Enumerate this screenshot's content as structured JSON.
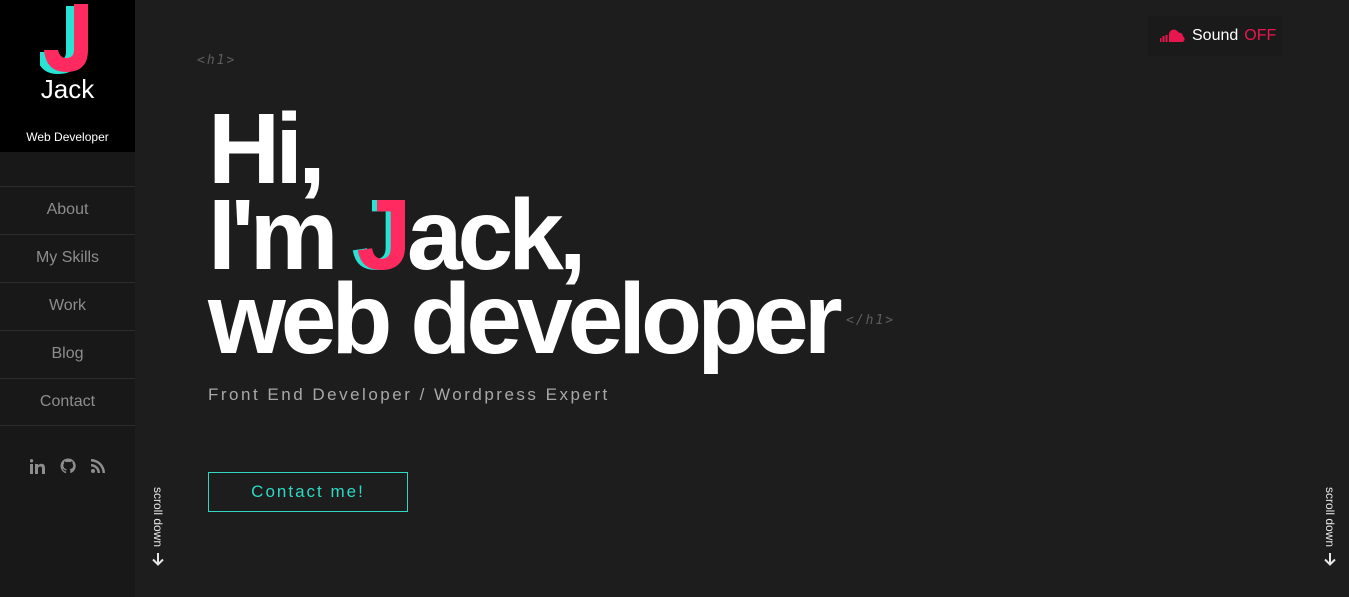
{
  "brand": {
    "name": "Jack",
    "title": "Web Developer"
  },
  "nav": [
    {
      "label": "About"
    },
    {
      "label": "My Skills"
    },
    {
      "label": "Work"
    },
    {
      "label": "Blog"
    },
    {
      "label": "Contact"
    }
  ],
  "social": [
    "linkedin-icon",
    "github-icon",
    "rss-icon"
  ],
  "sound": {
    "label": "Sound",
    "state": "OFF"
  },
  "tags": {
    "open": "<h1>",
    "close": "</h1>"
  },
  "hero": {
    "line1": "Hi,",
    "line2_pre": "I'm ",
    "line2_j": "J",
    "line2_post": "ack,",
    "line3": "web developer",
    "subtitle": "Front End Developer / Wordpress Expert",
    "cta": "Contact me!"
  },
  "scroll": {
    "label": "scroll down"
  },
  "colors": {
    "accent_pink": "#ff2a5f",
    "accent_teal": "#2dd9c4",
    "bg": "#1d1d1d",
    "sidebar": "#181818"
  }
}
